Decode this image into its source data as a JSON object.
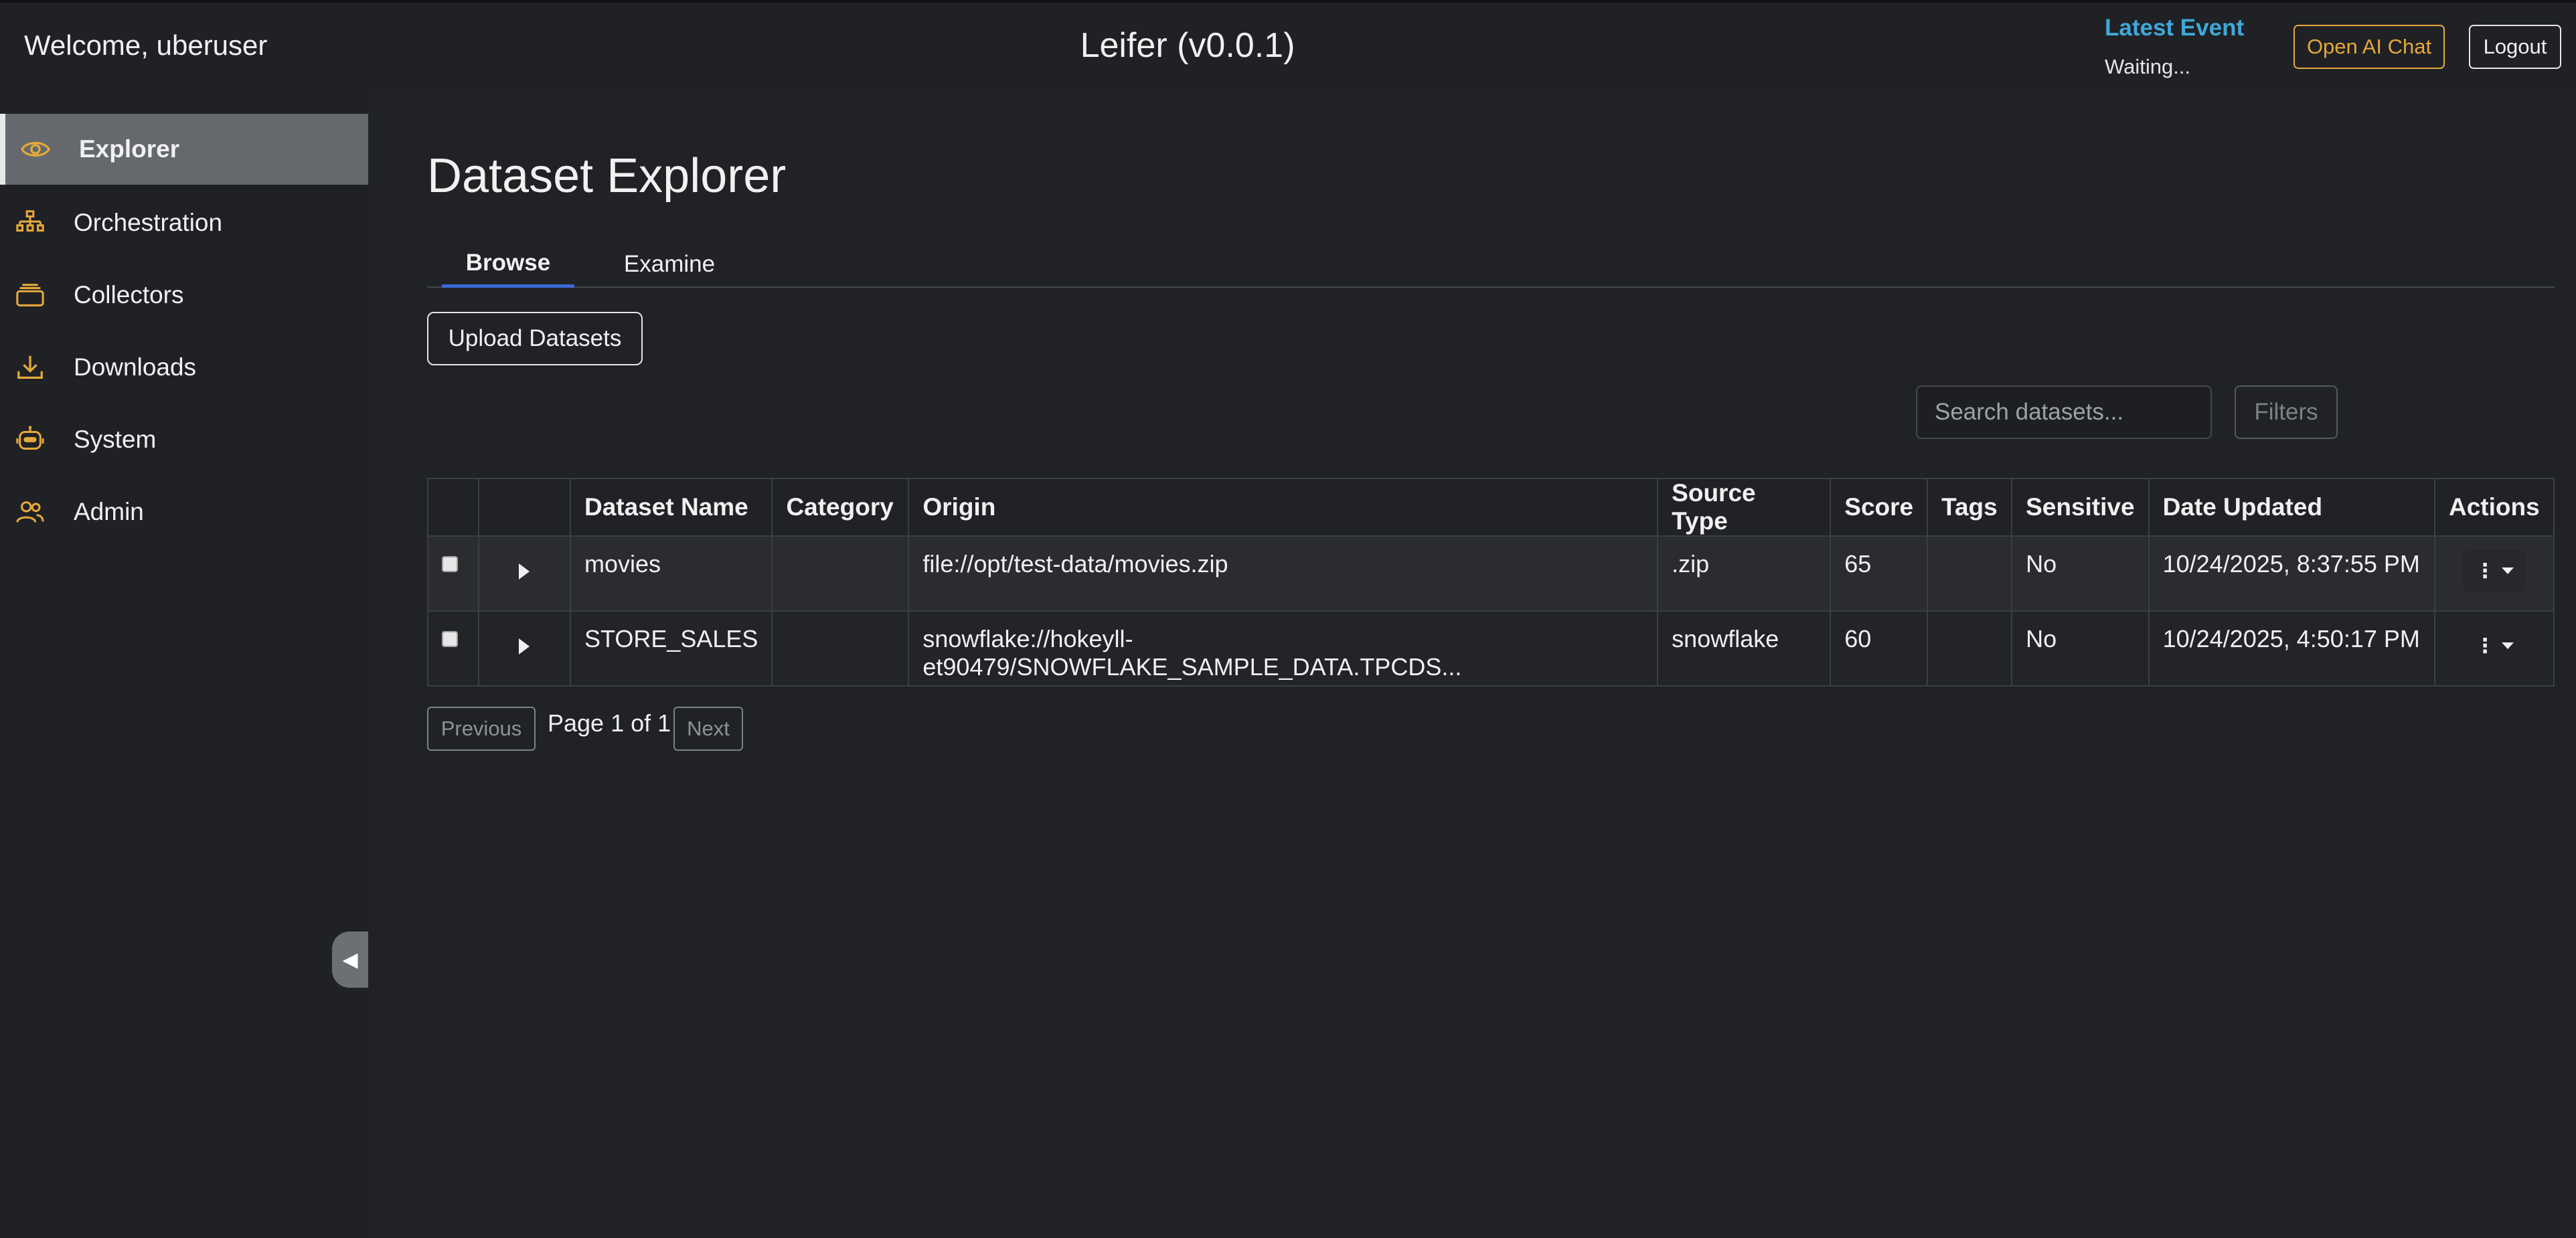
{
  "header": {
    "welcome": "Welcome, uberuser",
    "title": "Leifer (v0.0.1)",
    "latest_event_label": "Latest Event",
    "latest_event_status": "Waiting...",
    "ai_chat_label": "Open AI Chat",
    "logout_label": "Logout"
  },
  "sidebar": {
    "items": [
      {
        "label": "Explorer",
        "icon": "eye-icon",
        "active": true
      },
      {
        "label": "Orchestration",
        "icon": "hierarchy-icon",
        "active": false
      },
      {
        "label": "Collectors",
        "icon": "layers-icon",
        "active": false
      },
      {
        "label": "Downloads",
        "icon": "download-icon",
        "active": false
      },
      {
        "label": "System",
        "icon": "robot-icon",
        "active": false
      },
      {
        "label": "Admin",
        "icon": "users-icon",
        "active": false
      }
    ],
    "collapse_icon": "◀"
  },
  "main": {
    "title": "Dataset Explorer",
    "tabs": [
      {
        "label": "Browse",
        "active": true
      },
      {
        "label": "Examine",
        "active": false
      }
    ],
    "upload_label": "Upload Datasets",
    "search_placeholder": "Search datasets...",
    "filters_label": "Filters"
  },
  "table": {
    "columns": [
      "",
      "",
      "Dataset Name",
      "Category",
      "Origin",
      "Source Type",
      "Score",
      "Tags",
      "Sensitive",
      "Date Updated",
      "Actions"
    ],
    "rows": [
      {
        "name": "movies",
        "category": "",
        "origin": "file://opt/test-data/movies.zip",
        "source_type": ".zip",
        "score": "65",
        "tags": "",
        "sensitive": "No",
        "date_updated": "10/24/2025, 8:37:55 PM"
      },
      {
        "name": "STORE_SALES",
        "category": "",
        "origin": "snowflake://hokeyll-et90479/SNOWFLAKE_SAMPLE_DATA.TPCDS...",
        "source_type": "snowflake",
        "score": "60",
        "tags": "",
        "sensitive": "No",
        "date_updated": "10/24/2025, 4:50:17 PM"
      }
    ],
    "actions_glyph": "⋮"
  },
  "pagination": {
    "previous_label": "Previous",
    "info": "Page 1 of 1",
    "next_label": "Next"
  },
  "colors": {
    "accent_icon": "#e5a93a",
    "latest_event": "#3fa9d8",
    "tab_underline": "#3b6bd8",
    "background": "#202226"
  }
}
